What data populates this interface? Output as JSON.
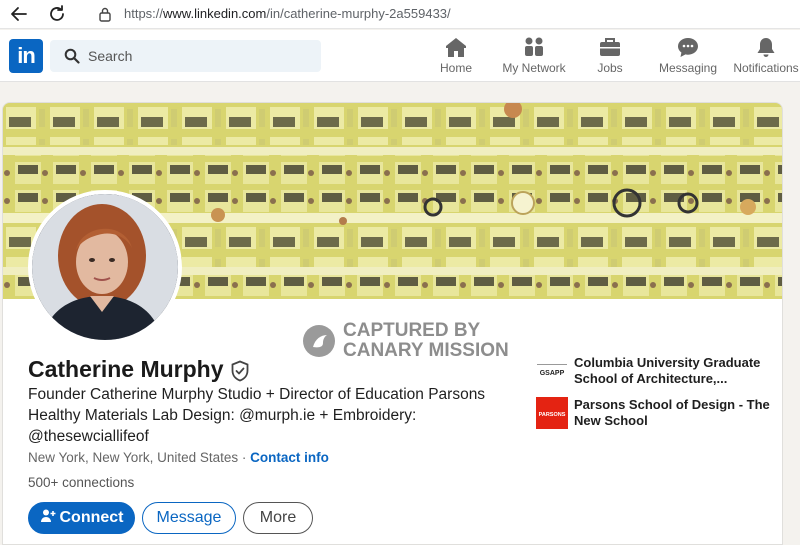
{
  "browser": {
    "url_prefix": "https://",
    "url_host": "www.linkedin.com",
    "url_path": "/in/catherine-murphy-2a559433/"
  },
  "header": {
    "logo": "in",
    "search_placeholder": "Search",
    "nav": [
      {
        "label": "Home",
        "icon": "home-icon"
      },
      {
        "label": "My Network",
        "icon": "network-icon"
      },
      {
        "label": "Jobs",
        "icon": "briefcase-icon"
      },
      {
        "label": "Messaging",
        "icon": "messaging-icon"
      },
      {
        "label": "Notifications",
        "icon": "bell-icon"
      }
    ]
  },
  "profile": {
    "name": "Catherine Murphy",
    "headline": "Founder Catherine Murphy Studio + Director of Education Parsons Healthy Materials Lab Design: @murph.ie + Embroidery: @thesewciallifeof",
    "location": "New York, New York, United States",
    "separator": " · ",
    "contact_info": "Contact info",
    "connections": "500+ connections",
    "buttons": {
      "connect": "Connect",
      "message": "Message",
      "more": "More"
    },
    "education": [
      {
        "name": "Columbia University Graduate School of Architecture,...",
        "logo_text": "GSAPP"
      },
      {
        "name": "Parsons School of Design - The New School",
        "logo_text": "PARSONS"
      }
    ]
  },
  "watermark": {
    "line1": "CAPTURED BY",
    "line2": "CANARY MISSION"
  },
  "colors": {
    "linkedin_blue": "#0a66c2",
    "banner_yellow": "#d9d673",
    "parsons_red": "#e42312"
  }
}
